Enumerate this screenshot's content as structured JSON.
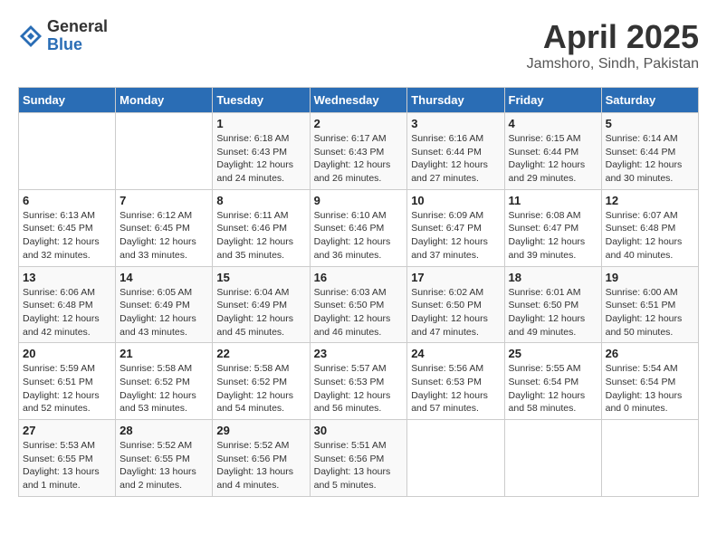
{
  "logo": {
    "general": "General",
    "blue": "Blue"
  },
  "title": "April 2025",
  "subtitle": "Jamshoro, Sindh, Pakistan",
  "days_of_week": [
    "Sunday",
    "Monday",
    "Tuesday",
    "Wednesday",
    "Thursday",
    "Friday",
    "Saturday"
  ],
  "weeks": [
    [
      {
        "day": "",
        "detail": ""
      },
      {
        "day": "",
        "detail": ""
      },
      {
        "day": "1",
        "detail": "Sunrise: 6:18 AM\nSunset: 6:43 PM\nDaylight: 12 hours and 24 minutes."
      },
      {
        "day": "2",
        "detail": "Sunrise: 6:17 AM\nSunset: 6:43 PM\nDaylight: 12 hours and 26 minutes."
      },
      {
        "day": "3",
        "detail": "Sunrise: 6:16 AM\nSunset: 6:44 PM\nDaylight: 12 hours and 27 minutes."
      },
      {
        "day": "4",
        "detail": "Sunrise: 6:15 AM\nSunset: 6:44 PM\nDaylight: 12 hours and 29 minutes."
      },
      {
        "day": "5",
        "detail": "Sunrise: 6:14 AM\nSunset: 6:44 PM\nDaylight: 12 hours and 30 minutes."
      }
    ],
    [
      {
        "day": "6",
        "detail": "Sunrise: 6:13 AM\nSunset: 6:45 PM\nDaylight: 12 hours and 32 minutes."
      },
      {
        "day": "7",
        "detail": "Sunrise: 6:12 AM\nSunset: 6:45 PM\nDaylight: 12 hours and 33 minutes."
      },
      {
        "day": "8",
        "detail": "Sunrise: 6:11 AM\nSunset: 6:46 PM\nDaylight: 12 hours and 35 minutes."
      },
      {
        "day": "9",
        "detail": "Sunrise: 6:10 AM\nSunset: 6:46 PM\nDaylight: 12 hours and 36 minutes."
      },
      {
        "day": "10",
        "detail": "Sunrise: 6:09 AM\nSunset: 6:47 PM\nDaylight: 12 hours and 37 minutes."
      },
      {
        "day": "11",
        "detail": "Sunrise: 6:08 AM\nSunset: 6:47 PM\nDaylight: 12 hours and 39 minutes."
      },
      {
        "day": "12",
        "detail": "Sunrise: 6:07 AM\nSunset: 6:48 PM\nDaylight: 12 hours and 40 minutes."
      }
    ],
    [
      {
        "day": "13",
        "detail": "Sunrise: 6:06 AM\nSunset: 6:48 PM\nDaylight: 12 hours and 42 minutes."
      },
      {
        "day": "14",
        "detail": "Sunrise: 6:05 AM\nSunset: 6:49 PM\nDaylight: 12 hours and 43 minutes."
      },
      {
        "day": "15",
        "detail": "Sunrise: 6:04 AM\nSunset: 6:49 PM\nDaylight: 12 hours and 45 minutes."
      },
      {
        "day": "16",
        "detail": "Sunrise: 6:03 AM\nSunset: 6:50 PM\nDaylight: 12 hours and 46 minutes."
      },
      {
        "day": "17",
        "detail": "Sunrise: 6:02 AM\nSunset: 6:50 PM\nDaylight: 12 hours and 47 minutes."
      },
      {
        "day": "18",
        "detail": "Sunrise: 6:01 AM\nSunset: 6:50 PM\nDaylight: 12 hours and 49 minutes."
      },
      {
        "day": "19",
        "detail": "Sunrise: 6:00 AM\nSunset: 6:51 PM\nDaylight: 12 hours and 50 minutes."
      }
    ],
    [
      {
        "day": "20",
        "detail": "Sunrise: 5:59 AM\nSunset: 6:51 PM\nDaylight: 12 hours and 52 minutes."
      },
      {
        "day": "21",
        "detail": "Sunrise: 5:58 AM\nSunset: 6:52 PM\nDaylight: 12 hours and 53 minutes."
      },
      {
        "day": "22",
        "detail": "Sunrise: 5:58 AM\nSunset: 6:52 PM\nDaylight: 12 hours and 54 minutes."
      },
      {
        "day": "23",
        "detail": "Sunrise: 5:57 AM\nSunset: 6:53 PM\nDaylight: 12 hours and 56 minutes."
      },
      {
        "day": "24",
        "detail": "Sunrise: 5:56 AM\nSunset: 6:53 PM\nDaylight: 12 hours and 57 minutes."
      },
      {
        "day": "25",
        "detail": "Sunrise: 5:55 AM\nSunset: 6:54 PM\nDaylight: 12 hours and 58 minutes."
      },
      {
        "day": "26",
        "detail": "Sunrise: 5:54 AM\nSunset: 6:54 PM\nDaylight: 13 hours and 0 minutes."
      }
    ],
    [
      {
        "day": "27",
        "detail": "Sunrise: 5:53 AM\nSunset: 6:55 PM\nDaylight: 13 hours and 1 minute."
      },
      {
        "day": "28",
        "detail": "Sunrise: 5:52 AM\nSunset: 6:55 PM\nDaylight: 13 hours and 2 minutes."
      },
      {
        "day": "29",
        "detail": "Sunrise: 5:52 AM\nSunset: 6:56 PM\nDaylight: 13 hours and 4 minutes."
      },
      {
        "day": "30",
        "detail": "Sunrise: 5:51 AM\nSunset: 6:56 PM\nDaylight: 13 hours and 5 minutes."
      },
      {
        "day": "",
        "detail": ""
      },
      {
        "day": "",
        "detail": ""
      },
      {
        "day": "",
        "detail": ""
      }
    ]
  ]
}
